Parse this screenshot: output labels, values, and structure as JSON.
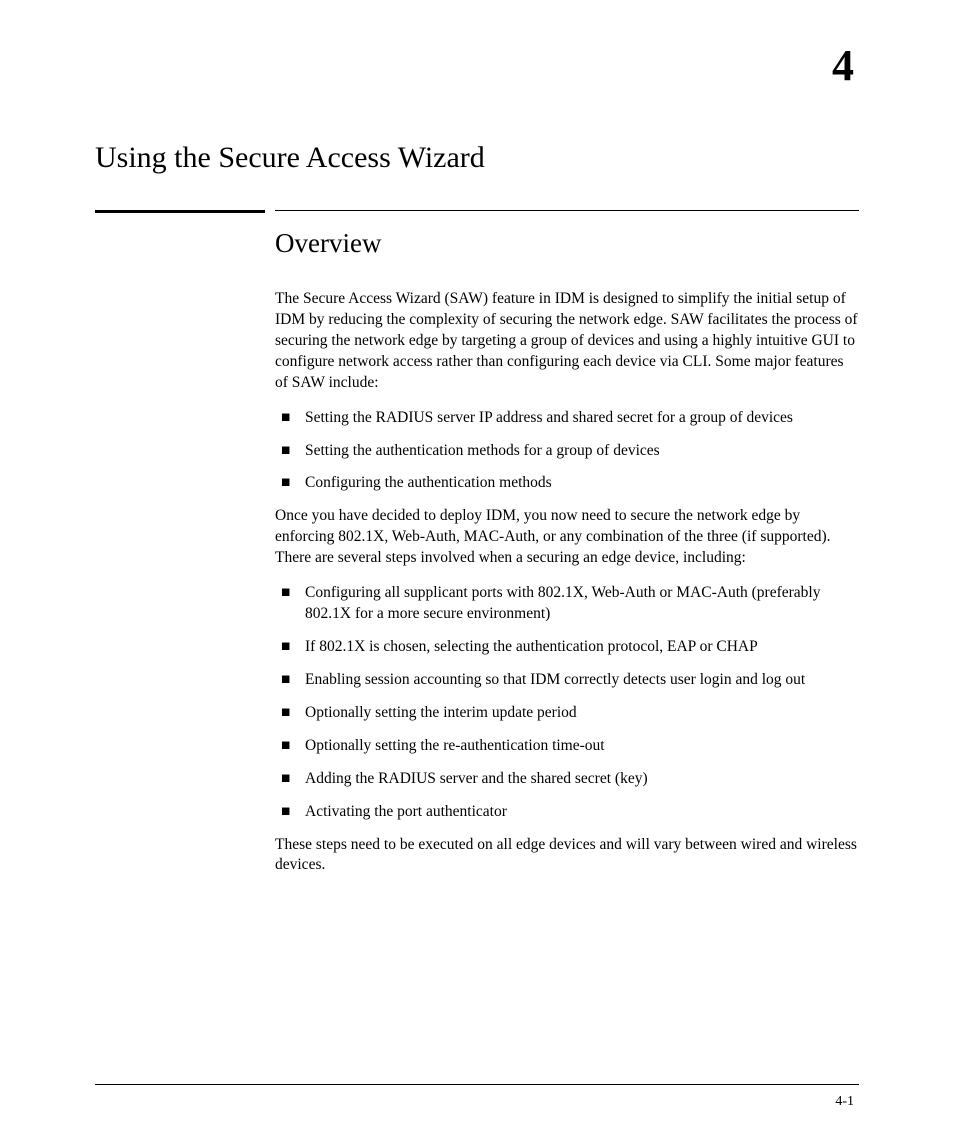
{
  "chapter": {
    "number": "4",
    "title": "Using the Secure Access Wizard"
  },
  "section": {
    "heading": "Overview",
    "para1": "The Secure Access Wizard (SAW) feature in IDM is designed to simplify the initial setup of IDM by reducing the complexity of securing the network edge. SAW facilitates the process of securing the network edge by targeting a group of devices and using a highly intuitive GUI to configure network access rather than configuring each device via CLI. Some major features of SAW include:",
    "list1": [
      "Setting the RADIUS server IP address and shared secret for a group of devices",
      "Setting the authentication methods for a group of devices",
      "Configuring the authentication methods"
    ],
    "para2": "Once you have decided to deploy IDM, you now need to secure the network edge by enforcing 802.1X, Web-Auth, MAC-Auth, or any combination of the three (if supported). There are several steps involved when a securing an edge device, including:",
    "list2": [
      "Configuring all supplicant ports with 802.1X, Web-Auth or MAC-Auth (preferably 802.1X for a more secure environment)",
      "If 802.1X is chosen, selecting the authentication protocol, EAP or CHAP",
      "Enabling session accounting so that IDM correctly detects user login and log out",
      "Optionally setting the interim update period",
      "Optionally setting the re-authentication time-out",
      "Adding the RADIUS server and the shared secret (key)",
      "Activating the port authenticator"
    ],
    "para3": "These steps need to be executed on all edge devices and will vary between wired and wireless devices."
  },
  "footer": {
    "page": "4-1"
  }
}
